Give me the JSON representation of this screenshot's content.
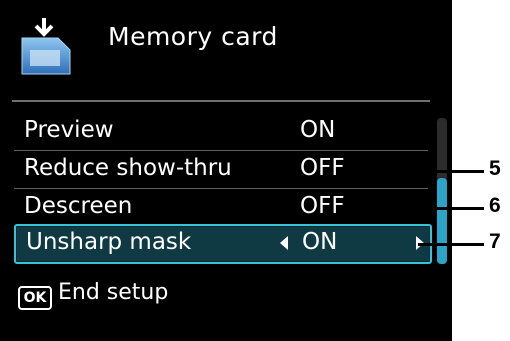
{
  "header": {
    "title": "Memory card",
    "icon": "memory-card-icon"
  },
  "settings": [
    {
      "label": "Preview",
      "value": "ON"
    },
    {
      "label": "Reduce show-thru",
      "value": "OFF"
    },
    {
      "label": "Descreen",
      "value": "OFF"
    },
    {
      "label": "Unsharp mask",
      "value": "ON",
      "selected": true
    }
  ],
  "footer": {
    "ok_key": "OK",
    "text": "End setup"
  },
  "callouts": [
    "5",
    "6",
    "7"
  ],
  "colors": {
    "screen_bg": "#000000",
    "selection_border": "#35c3d6",
    "scrollbar_thumb": "#2aa5c8"
  }
}
